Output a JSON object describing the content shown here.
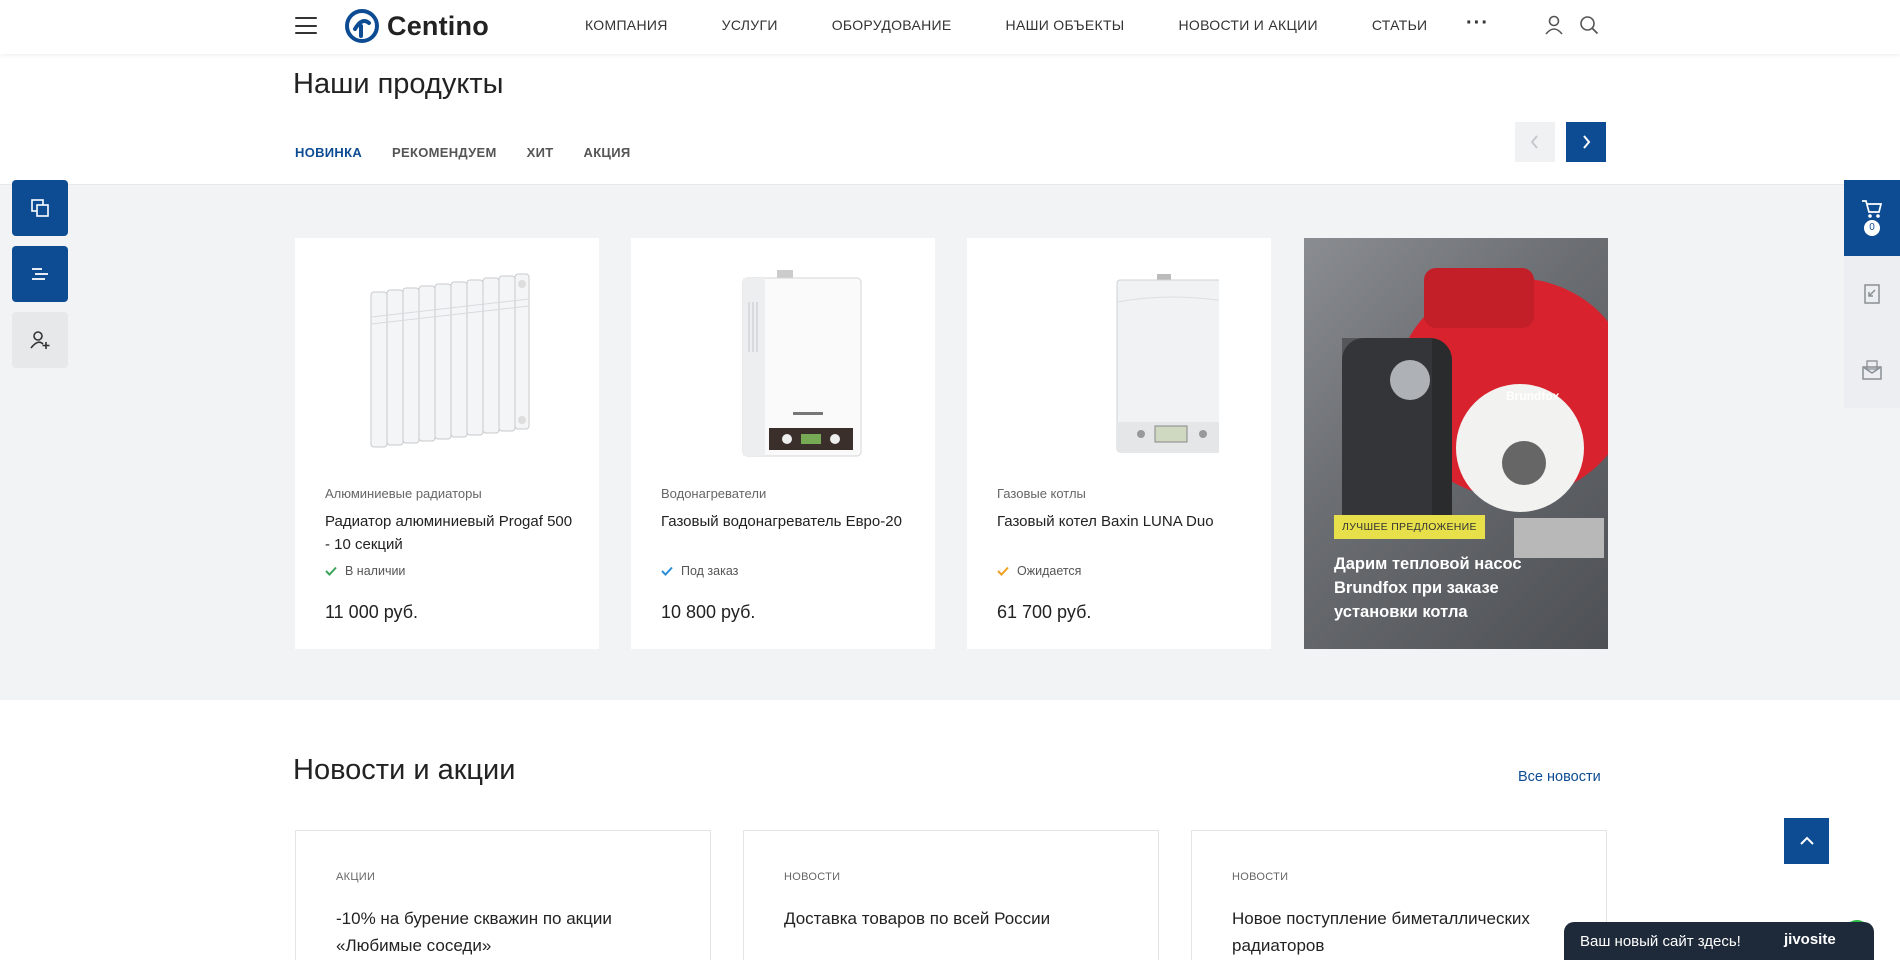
{
  "header": {
    "logo_text": "Centino",
    "nav": [
      "КОМПАНИЯ",
      "УСЛУГИ",
      "ОБОРУДОВАНИЕ",
      "НАШИ ОБЪЕКТЫ",
      "НОВОСТИ И АКЦИИ",
      "СТАТЬИ"
    ],
    "more": "···"
  },
  "products": {
    "title": "Наши продукты",
    "tabs": [
      "НОВИНКА",
      "РЕКОМЕНДУЕМ",
      "ХИТ",
      "АКЦИЯ"
    ],
    "active_tab": 0,
    "cards": [
      {
        "category": "Алюминиевые радиаторы",
        "name": "Радиатор алюминиевый Progaf 500 - 10 секций",
        "availability": "В наличии",
        "avail_color": "#3aa55a",
        "price": "11 000 руб."
      },
      {
        "category": "Водонагреватели",
        "name": "Газовый водонагреватель Евро-20",
        "availability": "Под заказ",
        "avail_color": "#2a8fd6",
        "price": "10 800 руб."
      },
      {
        "category": "Газовые котлы",
        "name": "Газовый котел Baxin LUNA Duo",
        "availability": "Ожидается",
        "avail_color": "#f0a020",
        "price": "61 700 руб."
      }
    ],
    "promo": {
      "badge": "ЛУЧШЕЕ ПРЕДЛОЖЕНИЕ",
      "text": "Дарим тепловой насос Brundfox при заказе установки котла",
      "brand": "Brundfox"
    }
  },
  "cart": {
    "count": "0"
  },
  "news": {
    "title": "Новости и акции",
    "all_link": "Все новости",
    "items": [
      {
        "category": "АКЦИИ",
        "title": "-10% на бурение скважин по акции «Любимые соседи»"
      },
      {
        "category": "НОВОСТИ",
        "title": "Доставка товаров по всей России"
      },
      {
        "category": "НОВОСТИ",
        "title": "Новое поступление биметаллических радиаторов"
      }
    ]
  },
  "chat": {
    "text": "Ваш новый сайт здесь!",
    "brand": "jivosite"
  },
  "colors": {
    "accent": "#0d4c93",
    "gray_bg": "#f2f3f5",
    "badge": "#e8e04a"
  }
}
